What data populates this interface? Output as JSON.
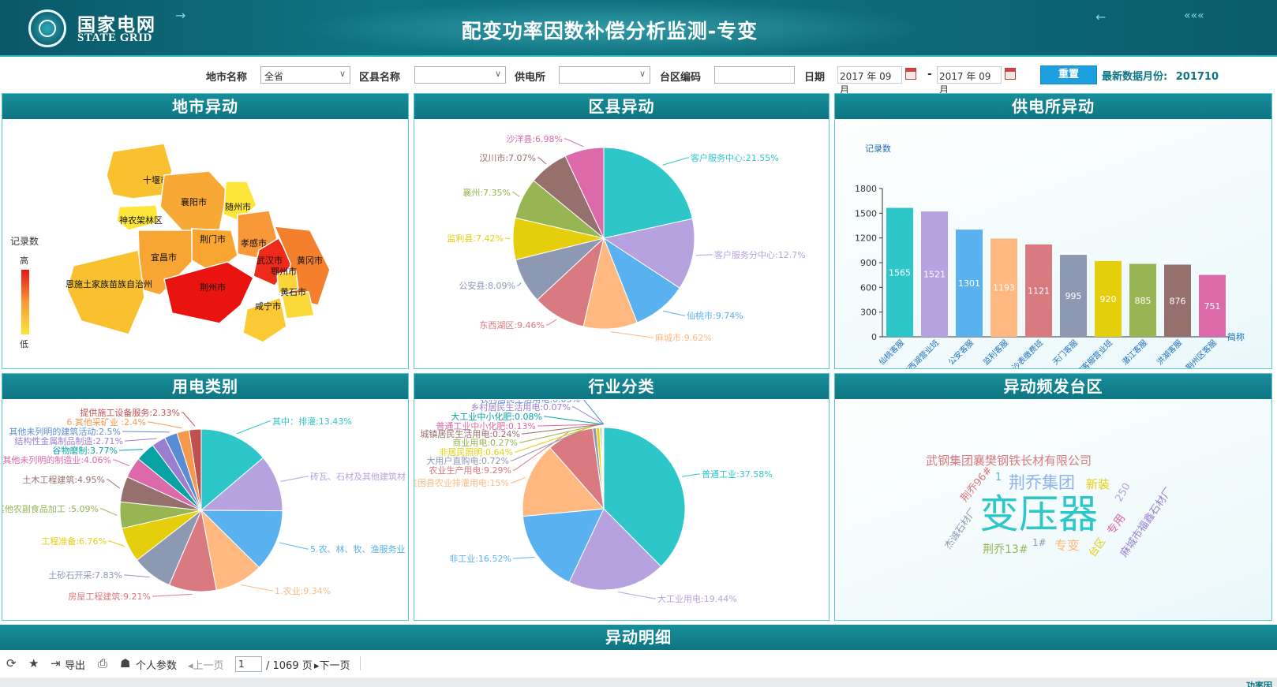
{
  "header": {
    "logo_cn": "国家电网",
    "logo_en": "STATE GRID",
    "title": "配变功率因数补偿分析监测-专变"
  },
  "filters": {
    "city_label": "地市名称",
    "city_value": "全省",
    "county_label": "区县名称",
    "county_value": "",
    "station_label": "供电所",
    "station_value": "",
    "area_code_label": "台区编码",
    "area_code_value": "",
    "date_label": "日期",
    "date_from": "2017 年 09 月",
    "date_to": "2017 年 09 月",
    "reset_label": "重置",
    "latest_label": "最新数据月份:",
    "latest_value": "201710"
  },
  "panels": {
    "city": "地市异动",
    "county": "区县异动",
    "station": "供电所异动",
    "usage": "用电类别",
    "industry": "行业分类",
    "hot": "异动频发台区"
  },
  "map": {
    "legend_title": "记录数",
    "legend_high": "高",
    "legend_low": "低",
    "regions": [
      {
        "name": "十堰市",
        "color": "#f9c12f"
      },
      {
        "name": "襄阳市",
        "color": "#f8a935"
      },
      {
        "name": "随州市",
        "color": "#fde639"
      },
      {
        "name": "神农架林区",
        "color": "#fde639"
      },
      {
        "name": "荆门市",
        "color": "#f8a532"
      },
      {
        "name": "孝感市",
        "color": "#f89838"
      },
      {
        "name": "宜昌市",
        "color": "#f8a533"
      },
      {
        "name": "武汉市",
        "color": "#ee2a1b"
      },
      {
        "name": "黄冈市",
        "color": "#f47f2c"
      },
      {
        "name": "鄂州市",
        "color": "#fbd43a"
      },
      {
        "name": "恩施土家族苗族自治州",
        "color": "#f9c12f"
      },
      {
        "name": "荆州市",
        "color": "#e9140f"
      },
      {
        "name": "黄石市",
        "color": "#fcd93b"
      },
      {
        "name": "咸宁市",
        "color": "#fbc934"
      }
    ]
  },
  "chart_data": [
    {
      "type": "pie",
      "id": "county",
      "slices": [
        {
          "label": "客户服务中心:21.55%",
          "value": 21.55,
          "color": "#2ec7c9"
        },
        {
          "label": "客户服务分中心:12.7%",
          "value": 12.7,
          "color": "#b6a2de"
        },
        {
          "label": "仙桃市:9.74%",
          "value": 9.74,
          "color": "#5ab1ef"
        },
        {
          "label": "麻城市:9.62%",
          "value": 9.62,
          "color": "#ffb980"
        },
        {
          "label": "东西湖区:9.46%",
          "value": 9.46,
          "color": "#d87a80"
        },
        {
          "label": "公安县:8.09%",
          "value": 8.09,
          "color": "#8d98b3"
        },
        {
          "label": "监利县:7.42%",
          "value": 7.42,
          "color": "#e5cf0d"
        },
        {
          "label": "襄州:7.35%",
          "value": 7.35,
          "color": "#97b552"
        },
        {
          "label": "汉川市:7.07%",
          "value": 7.07,
          "color": "#95706d"
        },
        {
          "label": "沙洋县:6.98%",
          "value": 6.98,
          "color": "#dc69aa"
        }
      ]
    },
    {
      "type": "bar",
      "id": "station",
      "ylabel": "记录数",
      "xlabel": "简称",
      "ylim": [
        0,
        1800
      ],
      "yticks": [
        "0",
        "300",
        "600",
        "900",
        "1200",
        "1500",
        "1800"
      ],
      "categories": [
        "仙桃客服",
        "东西湖营业班",
        "公安客服",
        "监利客服",
        "治沙表缴费班",
        "天门客服",
        "郑客服营业班",
        "潜江客服",
        "洪湖客服",
        "荆州区客服"
      ],
      "values": [
        1565,
        1521,
        1301,
        1193,
        1121,
        995,
        920,
        885,
        876,
        751
      ],
      "value_labels": [
        "1565",
        "1521",
        "1301",
        "1193",
        "1121",
        "995",
        "920",
        "885",
        "876",
        "751"
      ],
      "colors": [
        "#2ec7c9",
        "#b6a2de",
        "#5ab1ef",
        "#ffb980",
        "#d87a80",
        "#8d98b3",
        "#e5cf0d",
        "#97b552",
        "#95706d",
        "#dc69aa"
      ]
    },
    {
      "type": "pie",
      "id": "usage",
      "slices": [
        {
          "label": "其中：排灌:13.43%",
          "value": 13.43,
          "color": "#2ec7c9"
        },
        {
          "label": "砖瓦、石材及其他建筑材",
          "value": 11.0,
          "color": "#b6a2de"
        },
        {
          "label": "5.农、林、牧、渔服务业",
          "value": 12.0,
          "color": "#5ab1ef"
        },
        {
          "label": "1.农业:9.34%",
          "value": 9.34,
          "color": "#ffb980"
        },
        {
          "label": "房屋工程建筑:9.21%",
          "value": 9.21,
          "color": "#d87a80"
        },
        {
          "label": "土砂石开采:7.83%",
          "value": 7.83,
          "color": "#8d98b3"
        },
        {
          "label": "工程准备:6.76%",
          "value": 6.76,
          "color": "#e5cf0d"
        },
        {
          "label": "其他农副食品加工 :5.09%",
          "value": 5.09,
          "color": "#97b552"
        },
        {
          "label": "土木工程建筑:4.95%",
          "value": 4.95,
          "color": "#95706d"
        },
        {
          "label": "其他未列明的制造业:4.06%",
          "value": 4.06,
          "color": "#dc69aa"
        },
        {
          "label": "谷物磨制:3.77%",
          "value": 3.77,
          "color": "#07a2a4"
        },
        {
          "label": "结构性金属制品制造:2.71%",
          "value": 2.71,
          "color": "#9a7fd1"
        },
        {
          "label": "其他未列明的建筑活动:2.5%",
          "value": 2.5,
          "color": "#588dd5"
        },
        {
          "label": "6.其他采矿业 :2.4%",
          "value": 2.4,
          "color": "#f5994e"
        },
        {
          "label": "提供施工设备服务:2.33%",
          "value": 2.33,
          "color": "#c05050"
        }
      ]
    },
    {
      "type": "pie",
      "id": "industry",
      "slices": [
        {
          "label": "普通工业:37.58%",
          "value": 37.58,
          "color": "#2ec7c9"
        },
        {
          "label": "大工业用电:19.44%",
          "value": 19.44,
          "color": "#b6a2de"
        },
        {
          "label": "非工业:16.52%",
          "value": 16.52,
          "color": "#5ab1ef"
        },
        {
          "label": "贫困县农业排灌用电:15%",
          "value": 15.0,
          "color": "#ffb980"
        },
        {
          "label": "农业生产用电:9.29%",
          "value": 9.29,
          "color": "#d87a80"
        },
        {
          "label": "大用户直购电:0.72%",
          "value": 0.72,
          "color": "#8d98b3"
        },
        {
          "label": "非居民照明:0.64%",
          "value": 0.64,
          "color": "#e5cf0d"
        },
        {
          "label": "商业用电:0.27%",
          "value": 0.27,
          "color": "#97b552"
        },
        {
          "label": "城镇居民生活用电:0.24%",
          "value": 0.24,
          "color": "#95706d"
        },
        {
          "label": "普通工业中小化肥:0.13%",
          "value": 0.13,
          "color": "#dc69aa"
        },
        {
          "label": "大工业中小化肥:0.08%",
          "value": 0.08,
          "color": "#07a2a4"
        },
        {
          "label": "乡村居民生活用电:0.07%",
          "value": 0.07,
          "color": "#9a7fd1"
        },
        {
          "label": "农村居民生活用电:0.05%",
          "value": 0.05,
          "color": "#588dd5"
        }
      ]
    }
  ],
  "wordcloud": [
    {
      "text": "武钢集团襄樊钢铁长材有限公司",
      "color": "#d87a80"
    },
    {
      "text": "荆乔集团",
      "color": "#8fb0e8"
    },
    {
      "text": "新装",
      "color": "#e5cf0d"
    },
    {
      "text": "变压器",
      "color": "#2ec7c9"
    },
    {
      "text": "荆乔96#",
      "color": "#d87a80"
    },
    {
      "text": "1",
      "color": "#5ab1ef"
    },
    {
      "text": "杰诚石材厂",
      "color": "#8d98b3"
    },
    {
      "text": "荆乔13#",
      "color": "#97b552"
    },
    {
      "text": "1#",
      "color": "#8d98b3"
    },
    {
      "text": "专变",
      "color": "#ffb980"
    },
    {
      "text": "台区",
      "color": "#e5cf0d"
    },
    {
      "text": "250",
      "color": "#b6a2de"
    },
    {
      "text": "专用",
      "color": "#dc69aa"
    },
    {
      "text": "麻城市福鑫石材厂",
      "color": "#9a7fd1"
    }
  ],
  "detail": {
    "title": "异动明细",
    "export_label": "导出",
    "personal_label": "个人参数",
    "prev_label": "上一页",
    "page_value": "1",
    "page_total": "/ 1069 页",
    "next_label": "下一页",
    "corner_tab": "功率因"
  }
}
